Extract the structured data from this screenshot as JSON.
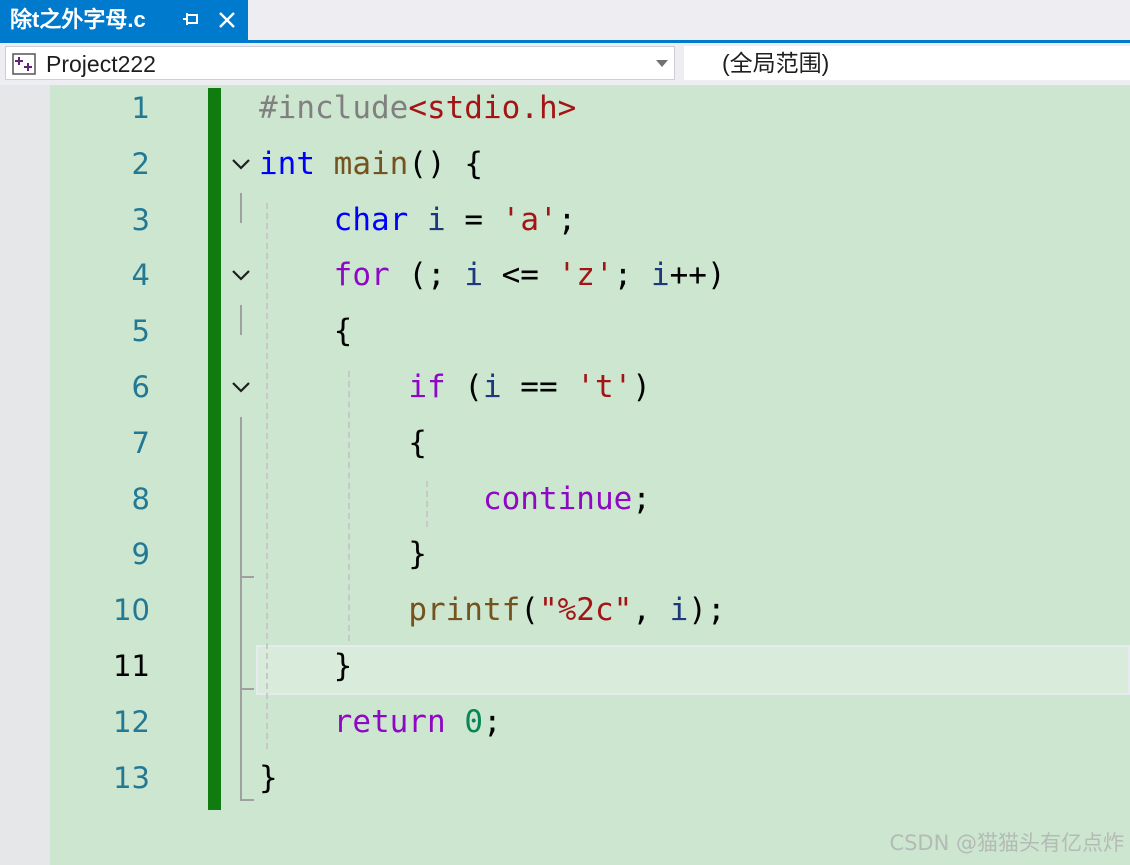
{
  "tab": {
    "title": "除t之外字母.c"
  },
  "navbar": {
    "project": "Project222",
    "scope": "(全局范围)"
  },
  "editor": {
    "line_numbers": [
      "1",
      "2",
      "3",
      "4",
      "5",
      "6",
      "7",
      "8",
      "9",
      "10",
      "11",
      "12",
      "13"
    ],
    "current_line": "11",
    "lines": [
      [
        {
          "t": "#include",
          "c": "pp"
        },
        {
          "t": "<stdio.h>",
          "c": "inc"
        }
      ],
      [
        {
          "t": "int",
          "c": "kw"
        },
        {
          "t": " ",
          "c": "txt"
        },
        {
          "t": "main",
          "c": "fn"
        },
        {
          "t": "() {",
          "c": "txt"
        }
      ],
      [
        {
          "t": "    ",
          "c": "txt"
        },
        {
          "t": "char",
          "c": "kw"
        },
        {
          "t": " ",
          "c": "txt"
        },
        {
          "t": "i",
          "c": "var"
        },
        {
          "t": " = ",
          "c": "txt"
        },
        {
          "t": "'a'",
          "c": "str"
        },
        {
          "t": ";",
          "c": "txt"
        }
      ],
      [
        {
          "t": "    ",
          "c": "txt"
        },
        {
          "t": "for",
          "c": "ctl"
        },
        {
          "t": " (; ",
          "c": "txt"
        },
        {
          "t": "i",
          "c": "var"
        },
        {
          "t": " <= ",
          "c": "txt"
        },
        {
          "t": "'z'",
          "c": "str"
        },
        {
          "t": "; ",
          "c": "txt"
        },
        {
          "t": "i",
          "c": "var"
        },
        {
          "t": "++)",
          "c": "txt"
        }
      ],
      [
        {
          "t": "    {",
          "c": "txt"
        }
      ],
      [
        {
          "t": "        ",
          "c": "txt"
        },
        {
          "t": "if",
          "c": "ctl"
        },
        {
          "t": " (",
          "c": "txt"
        },
        {
          "t": "i",
          "c": "var"
        },
        {
          "t": " == ",
          "c": "txt"
        },
        {
          "t": "'t'",
          "c": "str"
        },
        {
          "t": ")",
          "c": "txt"
        }
      ],
      [
        {
          "t": "        {",
          "c": "txt"
        }
      ],
      [
        {
          "t": "            ",
          "c": "txt"
        },
        {
          "t": "continue",
          "c": "ctl"
        },
        {
          "t": ";",
          "c": "txt"
        }
      ],
      [
        {
          "t": "        }",
          "c": "txt"
        }
      ],
      [
        {
          "t": "        ",
          "c": "txt"
        },
        {
          "t": "printf",
          "c": "fn"
        },
        {
          "t": "(",
          "c": "txt"
        },
        {
          "t": "\"%2c\"",
          "c": "str"
        },
        {
          "t": ", ",
          "c": "txt"
        },
        {
          "t": "i",
          "c": "var"
        },
        {
          "t": ");",
          "c": "txt"
        }
      ],
      [
        {
          "t": "    }",
          "c": "txt"
        }
      ],
      [
        {
          "t": "    ",
          "c": "txt"
        },
        {
          "t": "return",
          "c": "ctl"
        },
        {
          "t": " ",
          "c": "txt"
        },
        {
          "t": "0",
          "c": "num"
        },
        {
          "t": ";",
          "c": "txt"
        }
      ],
      [
        {
          "t": "}",
          "c": "txt"
        }
      ]
    ],
    "fold_lines": [
      2,
      4,
      6
    ]
  },
  "watermark": "CSDN @猫猫头有亿点炸",
  "colors": {
    "accent": "#007acc",
    "change_bar": "#107c10",
    "editor_bg": "#cde6cf",
    "keyword": "#0000ff",
    "control": "#8f08c4",
    "string": "#a31515",
    "function": "#74531f",
    "variable": "#1f377f"
  }
}
